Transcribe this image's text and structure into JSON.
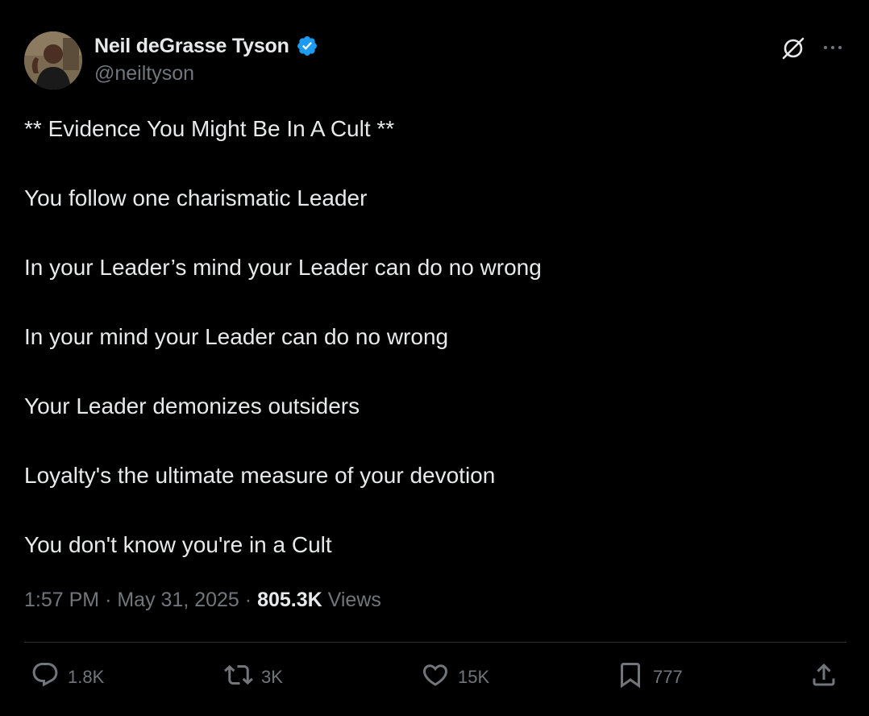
{
  "author": {
    "name": "Neil deGrasse Tyson",
    "handle": "@neiltyson",
    "verified": true,
    "verified_color": "#1d9bf0"
  },
  "tweet": {
    "lines": [
      "** Evidence You Might Be In A Cult **",
      "You follow one charismatic Leader",
      "In your Leader’s mind your Leader can do no wrong",
      "In your mind your Leader can do no wrong",
      "Your Leader demonizes outsiders",
      "Loyalty's the ultimate measure of your devotion",
      "You don't know you're in a Cult"
    ]
  },
  "meta": {
    "time": "1:57 PM",
    "separator": "·",
    "date": "May 31, 2025",
    "views_count": "805.3K",
    "views_label": "Views"
  },
  "actions": {
    "replies": "1.8K",
    "reposts": "3K",
    "likes": "15K",
    "bookmarks": "777"
  },
  "icons": {
    "header": [
      "grok-icon",
      "more-icon"
    ],
    "actions": [
      "reply-icon",
      "repost-icon",
      "like-icon",
      "bookmark-icon",
      "share-icon"
    ]
  },
  "colors": {
    "background": "#000000",
    "text_primary": "#e7e9ea",
    "text_secondary": "#71767b",
    "divider": "#2f3336"
  }
}
